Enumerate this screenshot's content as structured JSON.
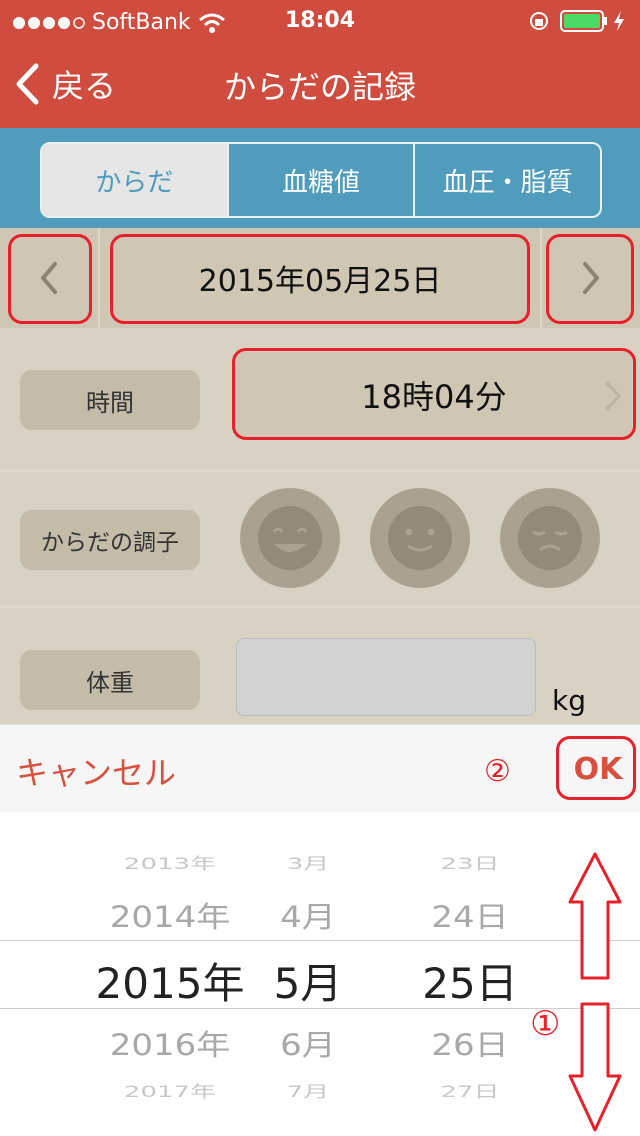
{
  "status": {
    "carrier": "SoftBank",
    "time": "18:04"
  },
  "nav": {
    "back_label": "戻る",
    "title": "からだの記録"
  },
  "tabs": [
    {
      "label": "からだ"
    },
    {
      "label": "血糖値"
    },
    {
      "label": "血圧・脂質"
    }
  ],
  "date": {
    "value": "2015年05月25日"
  },
  "time_row": {
    "label": "時間",
    "value": "18時04分"
  },
  "condition": {
    "label": "からだの調子"
  },
  "weight": {
    "label": "体重",
    "unit": "kg",
    "value": ""
  },
  "picker_toolbar": {
    "cancel_label": "キャンセル",
    "ok_label": "OK",
    "step_two_mark": "②"
  },
  "picker": {
    "step_one_mark": "①",
    "years": [
      "2013年",
      "2014年",
      "2015年",
      "2016年",
      "2017年"
    ],
    "months": [
      "3月",
      "4月",
      "5月",
      "6月",
      "7月"
    ],
    "days": [
      "23日",
      "24日",
      "25日",
      "26日",
      "27日"
    ]
  },
  "colors": {
    "nav_red": "#cf4c3e",
    "tab_blue": "#4f9cbd",
    "annotation_red": "#e8202a"
  }
}
